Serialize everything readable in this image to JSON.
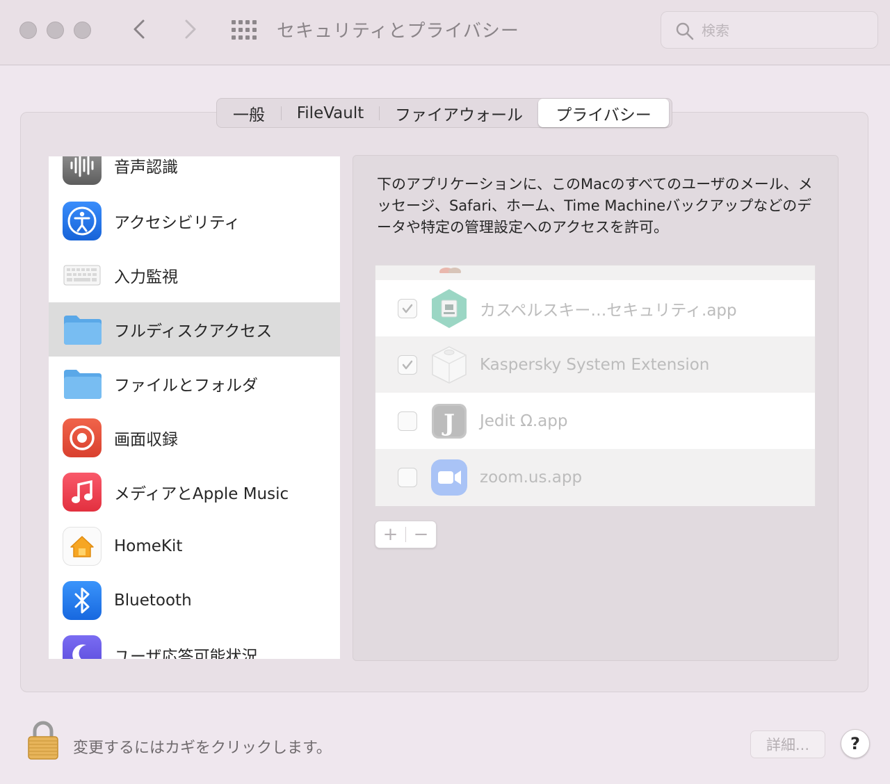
{
  "window": {
    "title": "セキュリティとプライバシー",
    "search_placeholder": "検索"
  },
  "tabs": [
    {
      "label": "一般"
    },
    {
      "label": "FileVault"
    },
    {
      "label": "ファイアウォール"
    },
    {
      "label": "プライバシー",
      "selected": true
    }
  ],
  "sidebar": {
    "items": [
      {
        "label": "音声認識",
        "icon": "waveform-icon"
      },
      {
        "label": "アクセシビリティ",
        "icon": "accessibility-icon"
      },
      {
        "label": "入力監視",
        "icon": "keyboard-icon"
      },
      {
        "label": "フルディスクアクセス",
        "icon": "folder-icon",
        "selected": true
      },
      {
        "label": "ファイルとフォルダ",
        "icon": "folder-icon"
      },
      {
        "label": "画面収録",
        "icon": "screen-record-icon"
      },
      {
        "label": "メディアとApple Music",
        "icon": "music-note-icon"
      },
      {
        "label": "HomeKit",
        "icon": "home-icon"
      },
      {
        "label": "Bluetooth",
        "icon": "bluetooth-icon"
      },
      {
        "label": "ユーザ応答可能状況",
        "icon": "moon-icon"
      }
    ]
  },
  "main": {
    "description": "下のアプリケーションに、このMacのすべてのユーザのメール、メッセージ、Safari、ホーム、Time Machineバックアップなどのデータや特定の管理設定へのアクセスを許可。",
    "apps": [
      {
        "name": "カスペルスキー…セキュリティ.app",
        "checked": true,
        "icon": "kaspersky-security-icon"
      },
      {
        "name": "Kaspersky System Extension",
        "checked": true,
        "icon": "extension-icon"
      },
      {
        "name": "Jedit Ω.app",
        "checked": false,
        "icon": "jedit-icon"
      },
      {
        "name": "zoom.us.app",
        "checked": false,
        "icon": "zoom-icon"
      }
    ],
    "add_label": "+",
    "remove_label": "−"
  },
  "footer": {
    "lock_text": "変更するにはカギをクリックします。",
    "details_label": "詳細...",
    "help_label": "?"
  }
}
